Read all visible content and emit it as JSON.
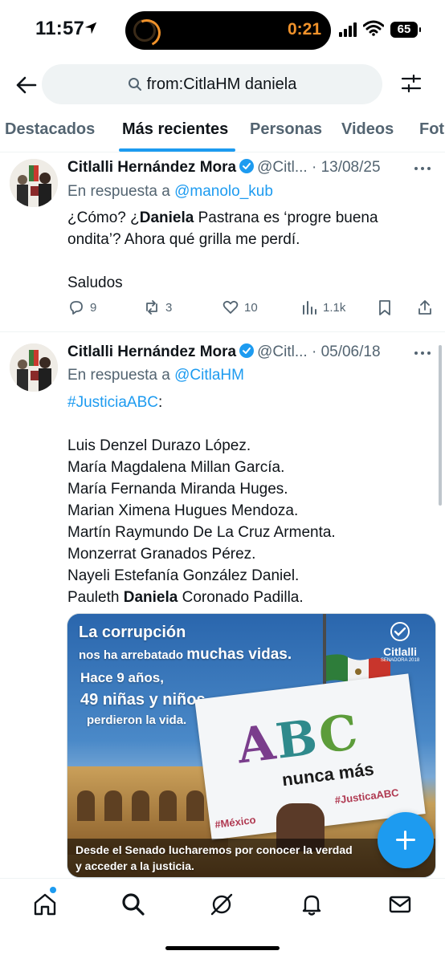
{
  "status_bar": {
    "time": "11:57",
    "timer": "0:21",
    "battery": "65"
  },
  "search": {
    "query": "from:CitlaHM daniela"
  },
  "tabs": [
    "Destacados",
    "Más recientes",
    "Personas",
    "Videos",
    "Fot"
  ],
  "active_tab": "Más recientes",
  "tweets": [
    {
      "name": "Citlalli Hernández Mora",
      "handle": "@Citl...",
      "date": "· 13/08/25",
      "reply_prefix": "En respuesta a",
      "reply_handle": "@manolo_kub",
      "text_l1a": "¿Cómo? ¿",
      "text_l1b": "Daniela",
      "text_l1c": " Pastrana es ‘progre buena",
      "text_l2": "ondita’? Ahora qué grilla me perdí.",
      "text_l3": "Saludos",
      "replies": "9",
      "retweets": "3",
      "likes": "10",
      "views": "1.1k"
    },
    {
      "name": "Citlalli Hernández Mora",
      "handle": "@Citl...",
      "date": "· 05/06/18",
      "reply_prefix": "En respuesta a",
      "reply_handle": "@CitlaHM",
      "hashtag": "#JusticiaABC",
      "hashtag_suffix": ":",
      "names": [
        "Luis Denzel Durazo López.",
        "María Magdalena Millan García.",
        "María Fernanda Miranda Huges.",
        "Marian Ximena Hugues Mendoza.",
        "Martín Raymundo De La Cruz Armenta.",
        "Monzerrat Granados Pérez.",
        "Nayeli Estefanía González Daniel."
      ],
      "last_name_a": "Pauleth ",
      "last_name_b": "Daniela",
      "last_name_c": " Coronado Padilla.",
      "media": {
        "l1": "La corrupción",
        "l2a": "nos ha arrebatado ",
        "l2b": "muchas vidas.",
        "l3": "Hace 9 años,",
        "l4": "49 niñas y niños",
        "l5": "perdieron la vida.",
        "sign_a": "A",
        "sign_b": "B",
        "sign_c": "C",
        "sign_sub": "nunca más",
        "tag_left": "#México",
        "tag_right": "#JusticaABC",
        "logo_small": "Citlalli",
        "logo_sub": "SENADORA 2018",
        "caption_l1": "Desde el Senado lucharemos por conocer la verdad",
        "caption_l2": "y acceder a la justicia."
      }
    }
  ],
  "colors": {
    "accent": "#1d9bf0",
    "text": "#0f1419",
    "muted": "#536471"
  }
}
